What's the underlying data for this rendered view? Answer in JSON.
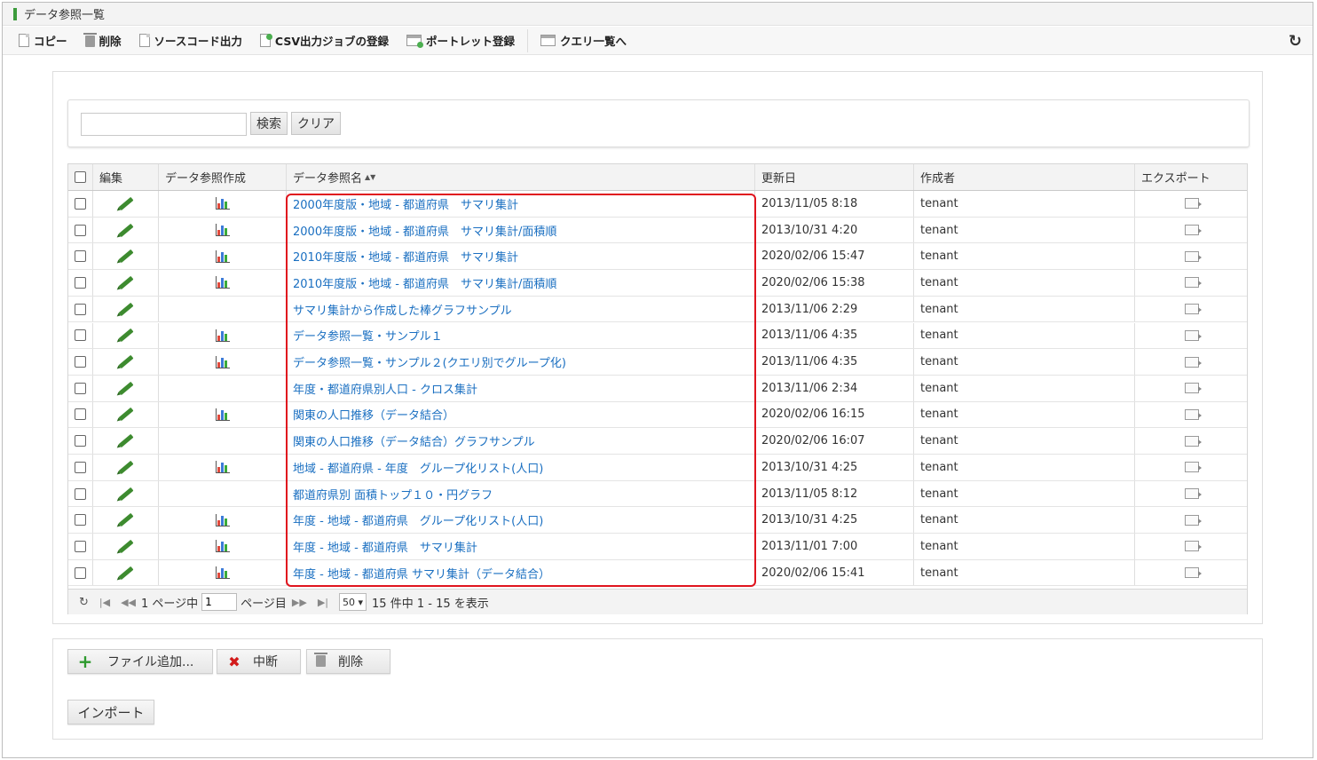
{
  "window": {
    "title": "データ参照一覧"
  },
  "toolbar": {
    "copy": "コピー",
    "delete": "削除",
    "source_output": "ソースコード出力",
    "csv_job": "CSV出力ジョブの登録",
    "portlet": "ポートレット登録",
    "query_list": "クエリ一覧へ",
    "refresh_icon": "refresh-icon"
  },
  "search": {
    "value": "",
    "search_label": "検索",
    "clear_label": "クリア"
  },
  "table": {
    "headers": {
      "edit": "編集",
      "create": "データ参照作成",
      "name": "データ参照名",
      "sort_mark": "▲▼",
      "updated": "更新日",
      "author": "作成者",
      "export": "エクスポート"
    },
    "rows": [
      {
        "name": "2000年度版・地域 - 都道府県　サマリ集計",
        "updated": "2013/11/05 8:18",
        "author": "tenant",
        "chart": true
      },
      {
        "name": "2000年度版・地域 - 都道府県　サマリ集計/面積順",
        "updated": "2013/10/31 4:20",
        "author": "tenant",
        "chart": true
      },
      {
        "name": "2010年度版・地域 - 都道府県　サマリ集計",
        "updated": "2020/02/06 15:47",
        "author": "tenant",
        "chart": true
      },
      {
        "name": "2010年度版・地域 - 都道府県　サマリ集計/面積順",
        "updated": "2020/02/06 15:38",
        "author": "tenant",
        "chart": true
      },
      {
        "name": "サマリ集計から作成した棒グラフサンプル",
        "updated": "2013/11/06 2:29",
        "author": "tenant",
        "chart": false
      },
      {
        "name": "データ参照一覧・サンプル１",
        "updated": "2013/11/06 4:35",
        "author": "tenant",
        "chart": true
      },
      {
        "name": "データ参照一覧・サンプル２(クエリ別でグループ化)",
        "updated": "2013/11/06 4:35",
        "author": "tenant",
        "chart": true
      },
      {
        "name": "年度・都道府県別人口 - クロス集計",
        "updated": "2013/11/06 2:34",
        "author": "tenant",
        "chart": false
      },
      {
        "name": "関東の人口推移（データ結合）",
        "updated": "2020/02/06 16:15",
        "author": "tenant",
        "chart": true
      },
      {
        "name": "関東の人口推移（データ結合）グラフサンプル",
        "updated": "2020/02/06 16:07",
        "author": "tenant",
        "chart": false
      },
      {
        "name": "地域 - 都道府県 - 年度　グループ化リスト(人口)",
        "updated": "2013/10/31 4:25",
        "author": "tenant",
        "chart": true
      },
      {
        "name": "都道府県別 面積トップ１０・円グラフ",
        "updated": "2013/11/05 8:12",
        "author": "tenant",
        "chart": false
      },
      {
        "name": "年度 - 地域 - 都道府県　グループ化リスト(人口)",
        "updated": "2013/10/31 4:25",
        "author": "tenant",
        "chart": true
      },
      {
        "name": "年度 - 地域 - 都道府県　サマリ集計",
        "updated": "2013/11/01 7:00",
        "author": "tenant",
        "chart": true
      },
      {
        "name": "年度 - 地域 - 都道府県 サマリ集計（データ結合）",
        "updated": "2020/02/06 15:41",
        "author": "tenant",
        "chart": true
      }
    ]
  },
  "pager": {
    "total_pages_prefix": "1 ページ中",
    "current_page": "1",
    "page_suffix": "ページ目",
    "per_page": "50",
    "summary": "15 件中 1 - 15 を表示"
  },
  "actions": {
    "add_file": "ファイル追加...",
    "abort": "中断",
    "delete": "削除",
    "import": "インポート"
  },
  "colors": {
    "link": "#1a6fc1",
    "highlight": "#e0141e",
    "edit_icon": "#3d8b2f"
  }
}
